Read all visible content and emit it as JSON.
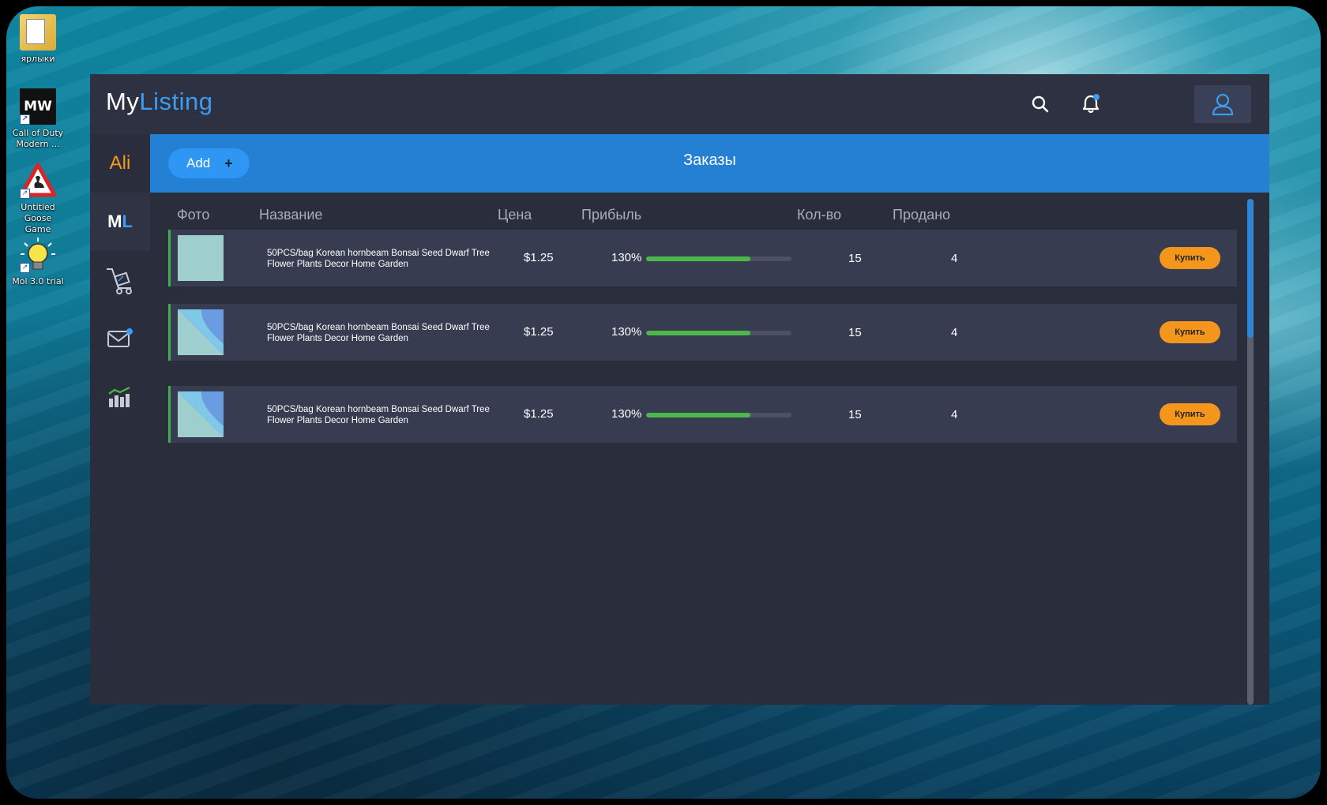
{
  "desktop": {
    "icons": [
      {
        "label": "ярлыки",
        "icon": "folder-icon"
      },
      {
        "label": "Call of Duty Modern ...",
        "icon": "mw-logo-icon"
      },
      {
        "label": "Untitled Goose Game",
        "icon": "goose-sign-icon"
      },
      {
        "label": "Mol 3.0 trial",
        "icon": "lightbulb-icon"
      }
    ]
  },
  "app": {
    "logo_prefix": "My",
    "logo_suffix": "Listing",
    "sidebar": {
      "ali_label": "Ali",
      "ml_prefix": "M",
      "ml_suffix": "L",
      "items": [
        {
          "icon": "cart-icon"
        },
        {
          "icon": "mail-icon"
        },
        {
          "icon": "chart-icon"
        }
      ]
    },
    "header": {
      "add_label": "Add",
      "add_icon": "+",
      "title": "Заказы"
    },
    "columns": {
      "photo": "Фото",
      "name": "Название",
      "price": "Цена",
      "profit": "Прибыль",
      "qty": "Кол-во",
      "sold": "Продано"
    },
    "rows": [
      {
        "name": "50PCS/bag Korean hornbeam Bonsai Seed Dwarf Tree Flower Plants Decor Home Garden",
        "price": "$1.25",
        "profit": "130%",
        "profit_fill": 0.72,
        "qty": "15",
        "sold": "4",
        "buy_label": "Купить"
      },
      {
        "name": "50PCS/bag Korean hornbeam Bonsai Seed Dwarf Tree Flower Plants Decor Home Garden",
        "price": "$1.25",
        "profit": "130%",
        "profit_fill": 0.72,
        "qty": "15",
        "sold": "4",
        "buy_label": "Купить"
      },
      {
        "name": "50PCS/bag Korean hornbeam Bonsai Seed Dwarf Tree Flower Plants Decor Home Garden",
        "price": "$1.25",
        "profit": "130%",
        "profit_fill": 0.72,
        "qty": "15",
        "sold": "4",
        "buy_label": "Купить"
      }
    ],
    "colors": {
      "accent": "#3d9cf0",
      "header_band": "#2380d2",
      "buy_button": "#f5961c",
      "progress": "#4cb84b",
      "ali": "#f39a23"
    }
  }
}
